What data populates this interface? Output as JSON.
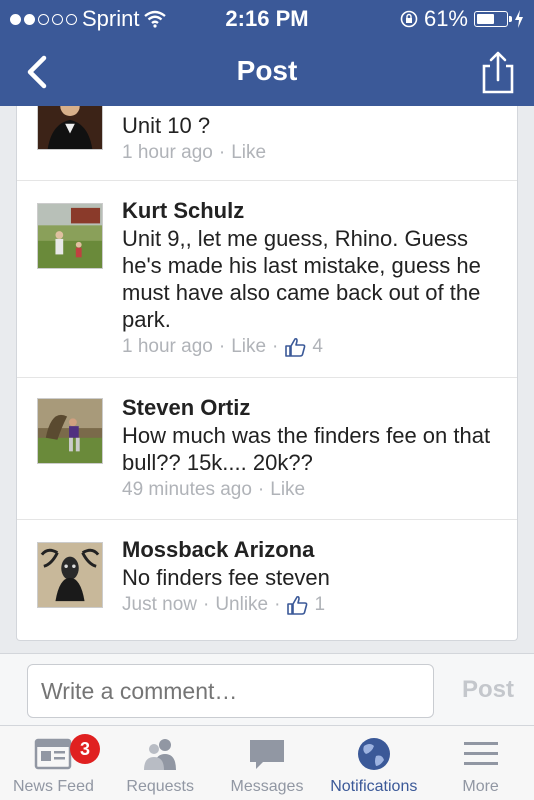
{
  "status": {
    "carrier": "Sprint",
    "time": "2:16 PM",
    "battery": "61%",
    "battery_level": 0.61
  },
  "nav": {
    "title": "Post"
  },
  "comments": [
    {
      "name": "",
      "text": "Unit 10 ?",
      "time": "1 hour ago",
      "action": "Like",
      "likes": ""
    },
    {
      "name": "Kurt Schulz",
      "text": "Unit 9,, let me guess, Rhino. Guess he's made his last mistake, guess he must have also came back out of the park.",
      "time": "1 hour ago",
      "action": "Like",
      "likes": "4"
    },
    {
      "name": "Steven Ortiz",
      "text": "How much was the finders fee on that bull?? 15k.... 20k??",
      "time": "49 minutes ago",
      "action": "Like",
      "likes": ""
    },
    {
      "name": "Mossback Arizona",
      "text": "No finders fee steven",
      "time": "Just now",
      "action": "Unlike",
      "likes": "1"
    }
  ],
  "compose": {
    "placeholder": "Write a comment…",
    "post_label": "Post"
  },
  "tabs": [
    {
      "label": "News Feed",
      "icon": "news-feed-icon",
      "badge": "3"
    },
    {
      "label": "Requests",
      "icon": "requests-icon"
    },
    {
      "label": "Messages",
      "icon": "messages-icon"
    },
    {
      "label": "Notifications",
      "icon": "notifications-globe-icon",
      "active": true
    },
    {
      "label": "More",
      "icon": "more-menu-icon"
    }
  ],
  "colors": {
    "brand": "#3b5998",
    "badge": "#e02020"
  }
}
